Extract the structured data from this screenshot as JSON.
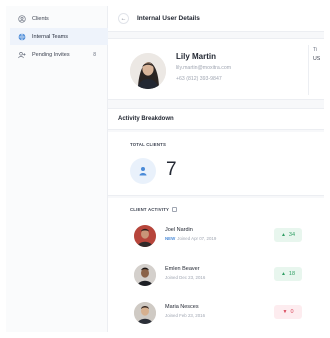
{
  "sidebar": {
    "items": [
      {
        "label": "Clients",
        "icon": "person-icon",
        "count": ""
      },
      {
        "label": "Internal Teams",
        "icon": "globe-icon",
        "count": ""
      },
      {
        "label": "Pending Invites",
        "icon": "person-add-icon",
        "count": "8"
      }
    ]
  },
  "header": {
    "back_symbol": "←",
    "title": "Internal User Details"
  },
  "profile": {
    "name": "Lily Martin",
    "email": "lily.martin@moxitra.com",
    "phone": "+63 (812) 393-9847",
    "side_label": "Ti",
    "side_value": "US"
  },
  "activity": {
    "section_title": "Activity Breakdown",
    "total_label": "TOTAL CLIENTS",
    "total_value": "7",
    "list_label": "CLIENT ACTIVITY",
    "rows": [
      {
        "name": "Joel Nardin",
        "badge": "NEW",
        "joined": "Joined Apr 07, 2019",
        "value": "34",
        "trend": "up"
      },
      {
        "name": "Emlen Beaver",
        "badge": "",
        "joined": "Joined Dec 23, 2016",
        "value": "18",
        "trend": "up"
      },
      {
        "name": "Maria Nesces",
        "badge": "",
        "joined": "Joined Feb 23, 2016",
        "value": "0",
        "trend": "down"
      }
    ]
  },
  "colors": {
    "accent": "#4b8bd8",
    "positive": "#2f9e63",
    "negative": "#d9465a"
  }
}
